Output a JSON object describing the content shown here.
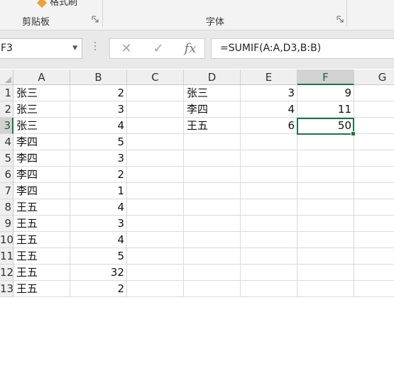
{
  "ribbon": {
    "format_painter_label": "格式刷",
    "clipboard_label": "剪贴板",
    "font_label": "字体"
  },
  "formula_bar": {
    "name_box": "F3",
    "cancel_icon": "✕",
    "enter_icon": "✓",
    "fx_icon": "fx",
    "formula": "=SUMIF(A:A,D3,B:B)"
  },
  "sheet": {
    "selected_cell": "F3",
    "columns": [
      "A",
      "B",
      "C",
      "D",
      "E",
      "F",
      "G"
    ],
    "row_headers": [
      "1",
      "2",
      "3",
      "4",
      "5",
      "6",
      "7",
      "8",
      "9",
      "10",
      "11",
      "12",
      "13"
    ],
    "col_A": [
      "张三",
      "张三",
      "张三",
      "李四",
      "李四",
      "李四",
      "李四",
      "王五",
      "王五",
      "王五",
      "王五",
      "王五",
      "王五"
    ],
    "col_B": [
      "2",
      "3",
      "4",
      "5",
      "3",
      "2",
      "1",
      "4",
      "3",
      "4",
      "5",
      "32",
      "2"
    ],
    "col_D": [
      "张三",
      "李四",
      "王五"
    ],
    "col_E": [
      "3",
      "4",
      "6"
    ],
    "col_F": [
      "9",
      "11",
      "50"
    ]
  },
  "colors": {
    "accent": "#217346",
    "header_bg": "#efefef",
    "selected_header_bg": "#d2d2d2"
  }
}
